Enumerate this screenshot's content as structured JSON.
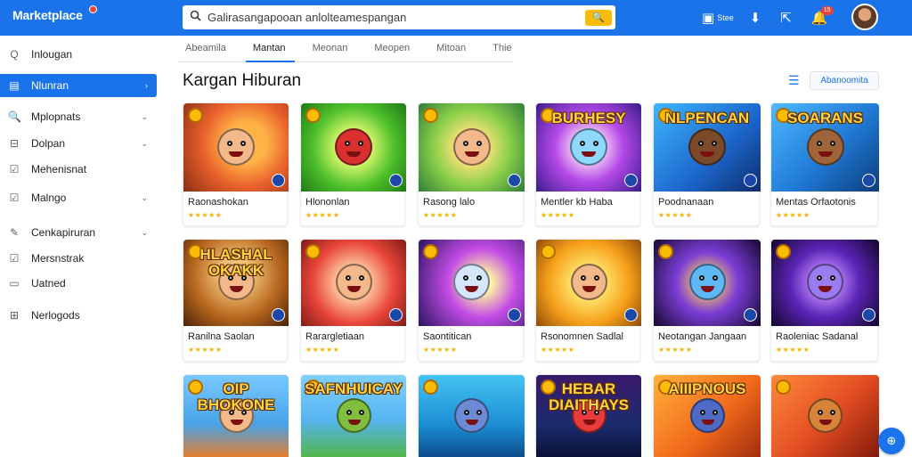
{
  "header": {
    "brand": "Marketplace",
    "search_text": "Galirasangapooan anlolteamespangan",
    "search_button": "🔍",
    "icons": [
      {
        "name": "store-icon",
        "glyph": "▣",
        "label": "Stee"
      },
      {
        "name": "download-icon",
        "glyph": "⬇",
        "label": ""
      },
      {
        "name": "share-icon",
        "glyph": "⇱",
        "label": ""
      },
      {
        "name": "notification-icon",
        "glyph": "🔔",
        "label": "",
        "badge": "15"
      }
    ]
  },
  "sidebar": {
    "items": [
      {
        "icon": "Q",
        "icon_name": "search-icon",
        "label": "Inlougan",
        "chevron": ""
      },
      {
        "icon": "▤",
        "icon_name": "grid-icon",
        "label": "Nlunran",
        "chevron": "›",
        "active": true
      },
      {
        "icon": "🔍",
        "icon_name": "magnifier-icon",
        "label": "Mplopnats",
        "chevron": "⌄"
      },
      {
        "icon": "⊟",
        "icon_name": "bookmark-icon",
        "label": "Dolpan",
        "chevron": "⌄"
      },
      {
        "icon": "☑",
        "icon_name": "check-icon",
        "label": "Mehenisnat",
        "chevron": ""
      },
      {
        "icon": "☑",
        "icon_name": "checkbox-icon",
        "label": "Malngo",
        "chevron": "⌄"
      },
      {
        "icon": "✎",
        "icon_name": "edit-icon",
        "label": "Cenkapiruran",
        "chevron": "⌄"
      },
      {
        "icon": "☑",
        "icon_name": "task-icon",
        "label": "Mersnstrak",
        "chevron": ""
      },
      {
        "icon": "▭",
        "icon_name": "document-icon",
        "label": "Uatned",
        "chevron": ""
      },
      {
        "icon": "⊞",
        "icon_name": "apps-icon",
        "label": "Nerlogods",
        "chevron": ""
      }
    ]
  },
  "tabs": [
    {
      "label": "Abeamila"
    },
    {
      "label": "Mantan",
      "active": true
    },
    {
      "label": "Meonan"
    },
    {
      "label": "Meopen"
    },
    {
      "label": "Mitoan"
    },
    {
      "label": "Thie"
    }
  ],
  "main": {
    "title": "Kargan Hiburan",
    "sort_label": "Abanoomita",
    "list_icon": "☰"
  },
  "cards": [
    {
      "title": "Raonashokan",
      "rating": "★★★★★",
      "caption": "",
      "theme": "orange"
    },
    {
      "title": "Hlononlan",
      "rating": "★★★★★",
      "caption": "",
      "theme": "green"
    },
    {
      "title": "Rasong lalo",
      "rating": "★★★★★",
      "caption": "",
      "theme": "lime"
    },
    {
      "title": "Mentler kb Haba",
      "rating": "★★★★★",
      "caption": "BURHESY",
      "theme": "purple"
    },
    {
      "title": "Poodnanaan",
      "rating": "★★★★★",
      "caption": "NLPENCAN",
      "theme": "blue"
    },
    {
      "title": "Mentas Orfaotonis",
      "rating": "★★★★★",
      "caption": "SOARANS",
      "theme": "blue2"
    },
    {
      "title": "Ranilna Saolan",
      "rating": "★★★★★",
      "caption": "HLASHAL OKAKK",
      "theme": "brown"
    },
    {
      "title": "Rarargletiaan",
      "rating": "★★★★★",
      "caption": "",
      "theme": "red"
    },
    {
      "title": "Saontitican",
      "rating": "★★★★★",
      "caption": "",
      "theme": "violet"
    },
    {
      "title": "Rsonomnen Sadlal",
      "rating": "★★★★★",
      "caption": "",
      "theme": "yellow"
    },
    {
      "title": "Neotangan Jangaan",
      "rating": "★★★★★",
      "caption": "",
      "theme": "night"
    },
    {
      "title": "Raoleniac Sadanal",
      "rating": "★★★★★",
      "caption": "",
      "theme": "night2"
    },
    {
      "title": "",
      "rating": "",
      "caption": "OIP BHOKONE",
      "theme": "sky"
    },
    {
      "title": "",
      "rating": "",
      "caption": "SAFNHUICAY",
      "theme": "sky2"
    },
    {
      "title": "",
      "rating": "",
      "caption": "",
      "theme": "aqua"
    },
    {
      "title": "",
      "rating": "",
      "caption": "HEBAR DIAITHAYS",
      "theme": "dark"
    },
    {
      "title": "",
      "rating": "",
      "caption": "AIIIPNOUS",
      "theme": "sunset"
    },
    {
      "title": "",
      "rating": "",
      "caption": "",
      "theme": "sunset2"
    }
  ],
  "fab_icon": "⊕"
}
